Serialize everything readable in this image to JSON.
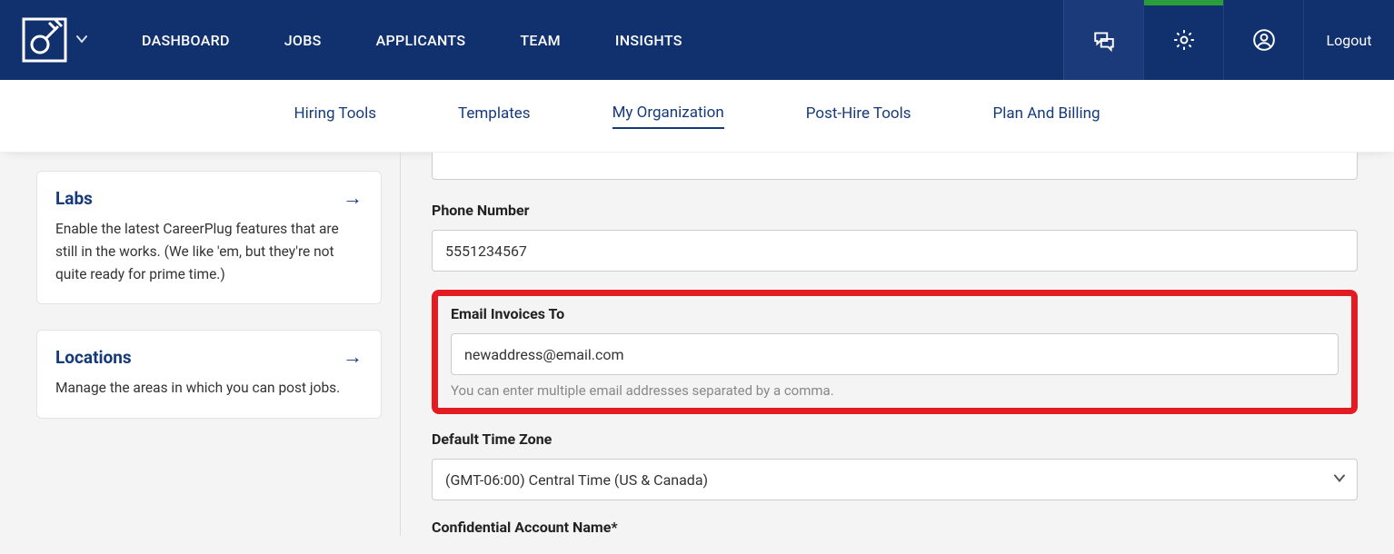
{
  "topnav": {
    "items": [
      "DASHBOARD",
      "JOBS",
      "APPLICANTS",
      "TEAM",
      "INSIGHTS"
    ],
    "logout": "Logout"
  },
  "subnav": {
    "items": [
      "Hiring Tools",
      "Templates",
      "My Organization",
      "Post-Hire Tools",
      "Plan And Billing"
    ],
    "active_index": 2
  },
  "sidebar": {
    "cards": [
      {
        "title": "Labs",
        "desc": "Enable the latest CareerPlug features that are still in the works. (We like 'em, but they're not quite ready for prime time.)"
      },
      {
        "title": "Locations",
        "desc": "Manage the areas in which you can post jobs."
      }
    ]
  },
  "form": {
    "phone": {
      "label": "Phone Number",
      "value": "5551234567"
    },
    "email_invoices": {
      "label": "Email Invoices To",
      "value": "newaddress@email.com",
      "help": "You can enter multiple email addresses separated by a comma."
    },
    "timezone": {
      "label": "Default Time Zone",
      "value": "(GMT-06:00) Central Time (US & Canada)"
    },
    "confidential_label": "Confidential Account Name*"
  },
  "colors": {
    "brand": "#10306e",
    "accent_green": "#2a9d3b",
    "highlight_red": "#e31b23",
    "link": "#153a7a"
  }
}
